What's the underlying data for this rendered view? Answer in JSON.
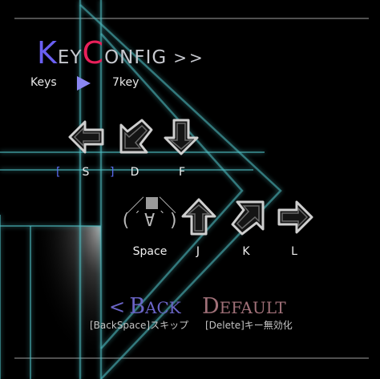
{
  "title": {
    "first_cap": "K",
    "first_rest": "EY",
    "second_cap": "C",
    "second_rest": "ONFIG",
    "suffix": ">>"
  },
  "mode": {
    "label": "Keys",
    "value": "7key"
  },
  "keys": [
    {
      "label": "S",
      "direction": "left",
      "selected": true,
      "icon": "arrow-left-icon"
    },
    {
      "label": "D",
      "direction": "down-left",
      "selected": false,
      "icon": "arrow-down-left-icon"
    },
    {
      "label": "F",
      "direction": "down",
      "selected": false,
      "icon": "arrow-down-icon"
    },
    {
      "label": "Space",
      "direction": "center",
      "selected": false,
      "icon": "face-emoticon-icon"
    },
    {
      "label": "J",
      "direction": "up",
      "selected": false,
      "icon": "arrow-up-icon"
    },
    {
      "label": "K",
      "direction": "up-right",
      "selected": false,
      "icon": "arrow-up-right-icon"
    },
    {
      "label": "L",
      "direction": "right",
      "selected": false,
      "icon": "arrow-right-icon"
    }
  ],
  "selection_brackets": {
    "open": "[",
    "close": "]"
  },
  "face_glyphs": {
    "top_left": "／",
    "top_right": "＼",
    "left": "(",
    "mouth": "∀",
    "cheek_left": "´",
    "cheek_right": "`",
    "right": ")"
  },
  "menu": {
    "back": {
      "arrow": "<",
      "cap": "B",
      "rest": "ACK",
      "hint": "[BackSpace]スキップ"
    },
    "default": {
      "cap": "D",
      "rest": "EFAULT",
      "hint": "[Delete]キー無効化"
    }
  },
  "colors": {
    "accent_blue": "#6a5ff2",
    "accent_pink": "#e8205a",
    "glow_cyan": "#5fd0d0",
    "back": "#6a64c6",
    "default": "#a07078"
  }
}
